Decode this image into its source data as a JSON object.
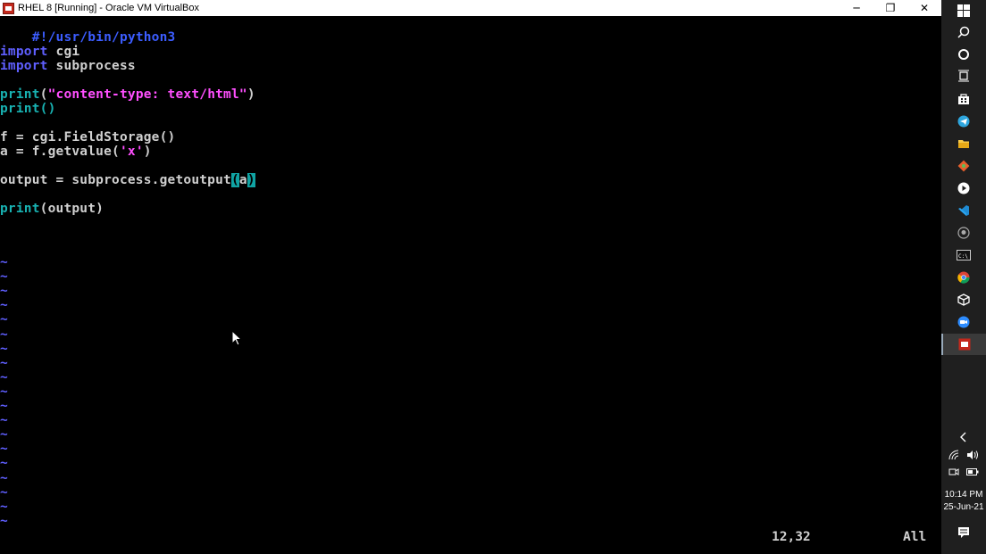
{
  "window": {
    "title": "RHEL 8 [Running] - Oracle VM VirtualBox",
    "controls": {
      "minimize": "─",
      "restore": "❐",
      "close": "✕"
    }
  },
  "editor": {
    "lines": {
      "shebang": "#!/usr/bin/python3",
      "import1_kw": "import",
      "import1_mod": " cgi",
      "import2_kw": "import",
      "import2_mod": " subprocess",
      "print1_fn": "print",
      "print1_open": "(",
      "print1_str": "\"content-type: text/html\"",
      "print1_close": ")",
      "print2": "print()",
      "line_f": "f = cgi.FieldStorage()",
      "line_a_pre": "a = f.getvalue(",
      "line_a_str": "'x'",
      "line_a_post": ")",
      "line_out_pre": "output = subprocess.getoutput",
      "line_out_paren_open": "(",
      "line_out_arg": "a",
      "line_out_paren_close": ")",
      "print3_fn": "print",
      "print3_args": "(output)"
    },
    "empty_line_marker": "~",
    "status": {
      "position": "12,32",
      "scroll": "All"
    }
  },
  "taskbar": {
    "icons": [
      "windows-start-icon",
      "search-icon",
      "cortana-icon",
      "task-view-icon",
      "store-icon",
      "telegram-icon",
      "file-explorer-icon",
      "git-icon",
      "media-player-icon",
      "vscode-icon",
      "github-icon",
      "terminal-icon",
      "chrome-icon",
      "virtualbox-icon",
      "zoom-icon",
      "rhel-vm-icon"
    ],
    "time": "10:14 PM",
    "date": "25-Jun-21"
  }
}
